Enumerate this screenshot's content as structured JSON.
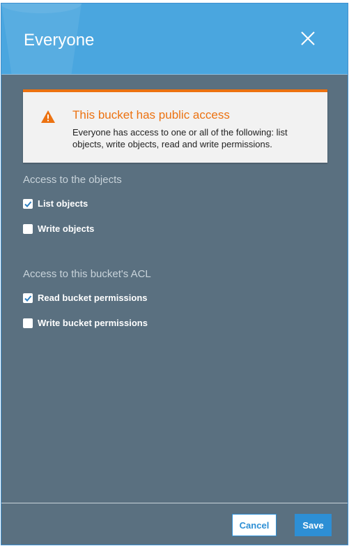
{
  "dialog": {
    "title": "Everyone",
    "close_icon": "close-icon"
  },
  "alert": {
    "icon": "warning-icon",
    "title": "This bucket has public access",
    "message": "Everyone has access to one or all of the following: list objects, write objects, read and write permissions."
  },
  "objects_section": {
    "label": "Access to the objects",
    "options": [
      {
        "label": "List objects",
        "checked": true
      },
      {
        "label": "Write objects",
        "checked": false
      }
    ]
  },
  "acl_section": {
    "label": "Access to this bucket's ACL",
    "options": [
      {
        "label": "Read bucket permissions",
        "checked": true
      },
      {
        "label": "Write bucket permissions",
        "checked": false
      }
    ]
  },
  "footer": {
    "cancel_label": "Cancel",
    "save_label": "Save"
  },
  "colors": {
    "header": "#4aa6df",
    "body": "#5a7080",
    "accent_orange": "#ec7211",
    "primary_blue": "#2d8fd5",
    "check_blue": "#2d7fc0"
  }
}
